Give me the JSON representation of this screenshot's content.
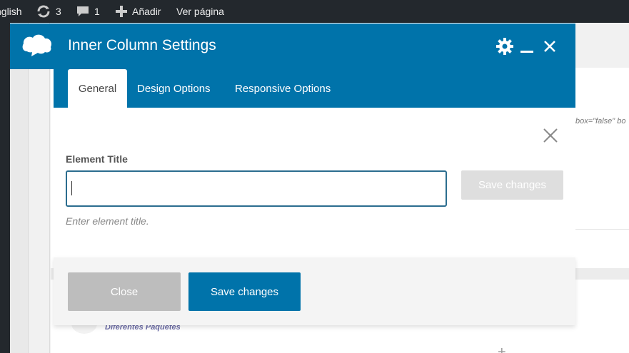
{
  "admin_bar": {
    "language": "nglish",
    "updates_count": "3",
    "comments_count": "1",
    "new_label": "Añadir",
    "view_label": "Ver página"
  },
  "background": {
    "code_snippet": "box=\"false\" bo",
    "paquetes_label": "Diferentes Paquetes"
  },
  "modal": {
    "title": "Inner Column Settings",
    "tabs": [
      {
        "label": "General",
        "active": true
      },
      {
        "label": "Design Options",
        "active": false
      },
      {
        "label": "Responsive Options",
        "active": false
      }
    ],
    "field_label": "Element Title",
    "field_value": "",
    "inline_save_label": "Save changes",
    "helper_text": "Enter element title.",
    "footer": {
      "close_label": "Close",
      "save_label": "Save changes"
    }
  },
  "colors": {
    "accent": "#0073aa",
    "admin_bar": "#23282d",
    "input_border": "#2b6d8f",
    "disabled_button": "#dedede",
    "close_button": "#bdbdbd"
  },
  "icons": [
    "update-icon",
    "comment-icon",
    "plus-icon",
    "cloud-logo-icon",
    "gear-icon",
    "minimize-icon",
    "close-icon"
  ]
}
